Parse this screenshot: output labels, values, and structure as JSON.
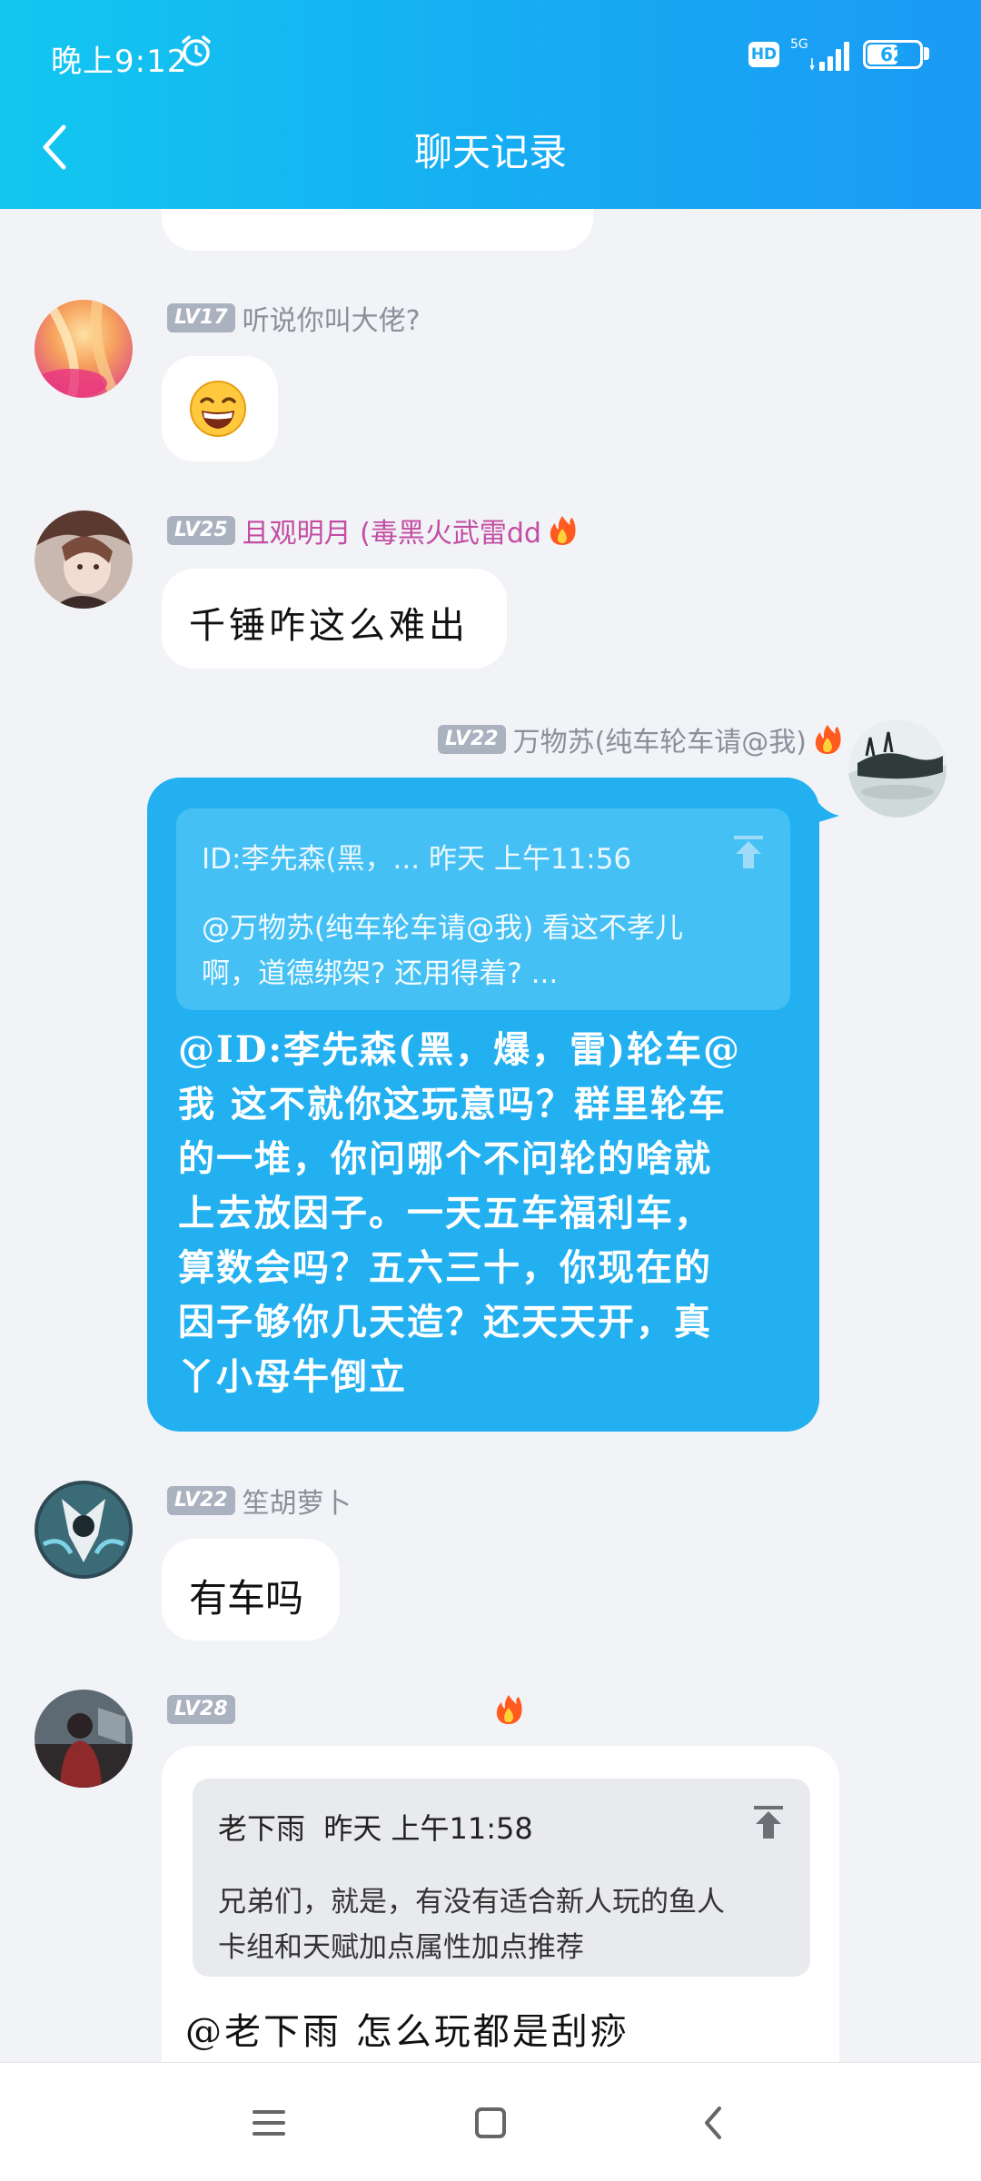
{
  "status_bar": {
    "time": "晚上9:12",
    "hd": "HD",
    "network": "5G",
    "battery": "62"
  },
  "header": {
    "title": "聊天记录"
  },
  "messages": [
    {
      "id": "m0",
      "text": ""
    },
    {
      "id": "m1",
      "level": "LV17",
      "name": "听说你叫大佬?",
      "emoji": "grinning-face"
    },
    {
      "id": "m2",
      "level": "LV25",
      "name": "且观明月 (毒黑火武雷dd",
      "text": "千锤咋这么难出"
    },
    {
      "id": "m3",
      "level": "LV22",
      "name": "万物苏(纯车轮车请@我)",
      "quote": {
        "header": "ID:李先森(黑，... 昨天 上午11:56",
        "body_line1": "@万物苏(纯车轮车请@我) 看这不孝儿",
        "body_line2": "啊，道德绑架? 还用得着? ..."
      },
      "text_lines": [
        "@ID:李先森(黑，爆，雷)轮车@",
        "我 这不就你这玩意吗？群里轮车",
        "的一堆，你问哪个不问轮的啥就",
        "上去放因子。一天五车福利车，",
        "算数会吗？五六三十，你现在的",
        "因子够你几天造？还天天开，真",
        "丫小母牛倒立"
      ]
    },
    {
      "id": "m4",
      "level": "LV22",
      "name": "笙胡萝卜",
      "text": "有车吗"
    },
    {
      "id": "m5",
      "level": "LV28",
      "name": "",
      "quote": {
        "header": "老下雨  昨天 上午11:58",
        "body_line1": "兄弟们，就是，有没有适合新人玩的鱼人",
        "body_line2": "卡组和天赋加点属性加点推荐"
      },
      "text": "@老下雨 怎么玩都是刮痧"
    }
  ],
  "colors": {
    "header_start": "#12c7f0",
    "header_end": "#1a9af4",
    "bubble_blue": "#23b0f0",
    "background": "#f2f3f7"
  },
  "icons": [
    "alarm-icon",
    "signal-icon",
    "battery-icon",
    "back-arrow-icon",
    "flame-icon",
    "pin-icon",
    "menu-icon",
    "home-icon",
    "nav-back-icon"
  ]
}
